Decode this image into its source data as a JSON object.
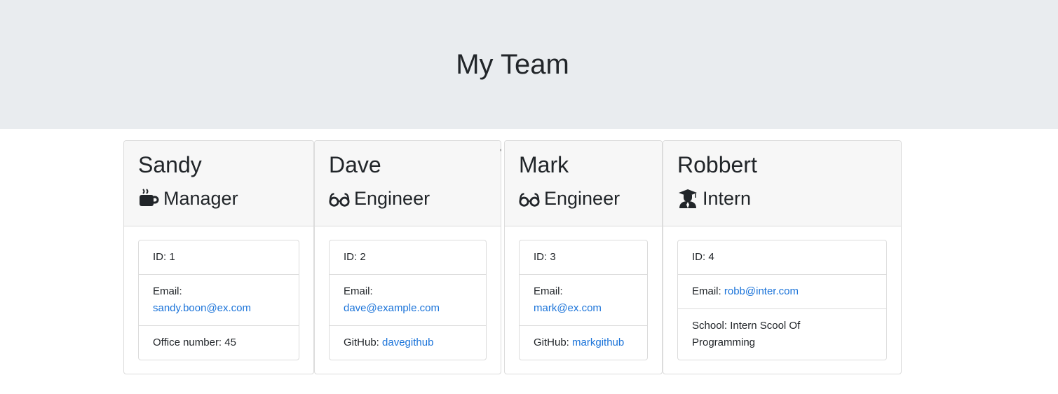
{
  "header": {
    "title": "My Team"
  },
  "cards": [
    {
      "name": "Sandy",
      "role": "Manager",
      "icon": "coffee-mug-icon",
      "id_label": "ID: 1",
      "email_label": "Email:",
      "email": "sandy.boon@ex.com",
      "extra_label": "Office number: 45",
      "extra_link": ""
    },
    {
      "name": "Dave",
      "role": "Engineer",
      "icon": "glasses-icon",
      "id_label": "ID: 2",
      "email_label": "Email:",
      "email": "dave@example.com",
      "extra_label": "GitHub:",
      "extra_link": "davegithub"
    },
    {
      "name": "Mark",
      "role": "Engineer",
      "icon": "glasses-icon",
      "id_label": "ID: 3",
      "email_label": "Email:",
      "email": "mark@ex.com",
      "extra_label": "GitHub:",
      "extra_link": "markgithub"
    },
    {
      "name": "Robbert",
      "role": "Intern",
      "icon": "graduate-icon",
      "id_label": "ID: 4",
      "email_label": "Email:",
      "email": "robb@inter.com",
      "extra_label": "School: Intern Scool Of Programming",
      "extra_link": ""
    }
  ],
  "colors": {
    "header_bg": "#e9ecef",
    "card_header_bg": "#f7f7f7",
    "link": "#1a73d9",
    "border": "#dcdcdc"
  }
}
